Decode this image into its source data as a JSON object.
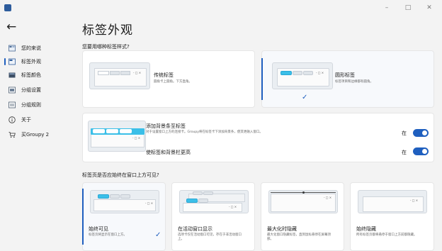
{
  "window": {
    "minimize": "–",
    "maximize": "□",
    "close": "✕"
  },
  "nav": {
    "back": "←",
    "items": [
      {
        "label": "您的来说"
      },
      {
        "label": "标签外观"
      },
      {
        "label": "标签颜色"
      },
      {
        "label": "分组设置"
      },
      {
        "label": "分组规则"
      },
      {
        "label": "关于"
      },
      {
        "label": "买Groupy 2"
      }
    ]
  },
  "page": {
    "title": "标签外观",
    "q1": "您要用哪种标签样式?",
    "style_options": [
      {
        "title": "传统标签",
        "desc": "圆角卡上圆角。下方直角。",
        "selected": false
      },
      {
        "title": "圆形标签",
        "desc": "标签项目和边缘都有圆角。",
        "selected": true
      }
    ],
    "background_option": {
      "title": "添加背景条至标签",
      "desc": "对于设置窗口上方的连接卡。Groupy将在标签卡下添加背景条，使其更融入窗口。",
      "toggle1_label": "在",
      "secondary": "使标签和背景栏更高",
      "toggle2_label": "在"
    },
    "q2": "标签页是否应始终在窗口上方可见?",
    "visibility_options": [
      {
        "title": "始终可见",
        "desc": "标签页将显示在窗口上方。",
        "selected": true
      },
      {
        "title": "在活动窗口显示",
        "desc": "选项卡仅在活动窗口可见，存在于非活动窗口上。",
        "selected": false
      },
      {
        "title": "最大化时隐藏",
        "desc": "最大化窗口隐藏标签，直到鼠标悬停在屏幕顶部。",
        "selected": false
      },
      {
        "title": "始终隐藏",
        "desc": "所有标签页都将悬停于窗口上方前都隐藏。",
        "selected": false
      }
    ]
  },
  "mock_window_controls": "- □ ×",
  "colors": {
    "accent": "#1f5fbf",
    "tab_active": "#3bbfe8"
  }
}
